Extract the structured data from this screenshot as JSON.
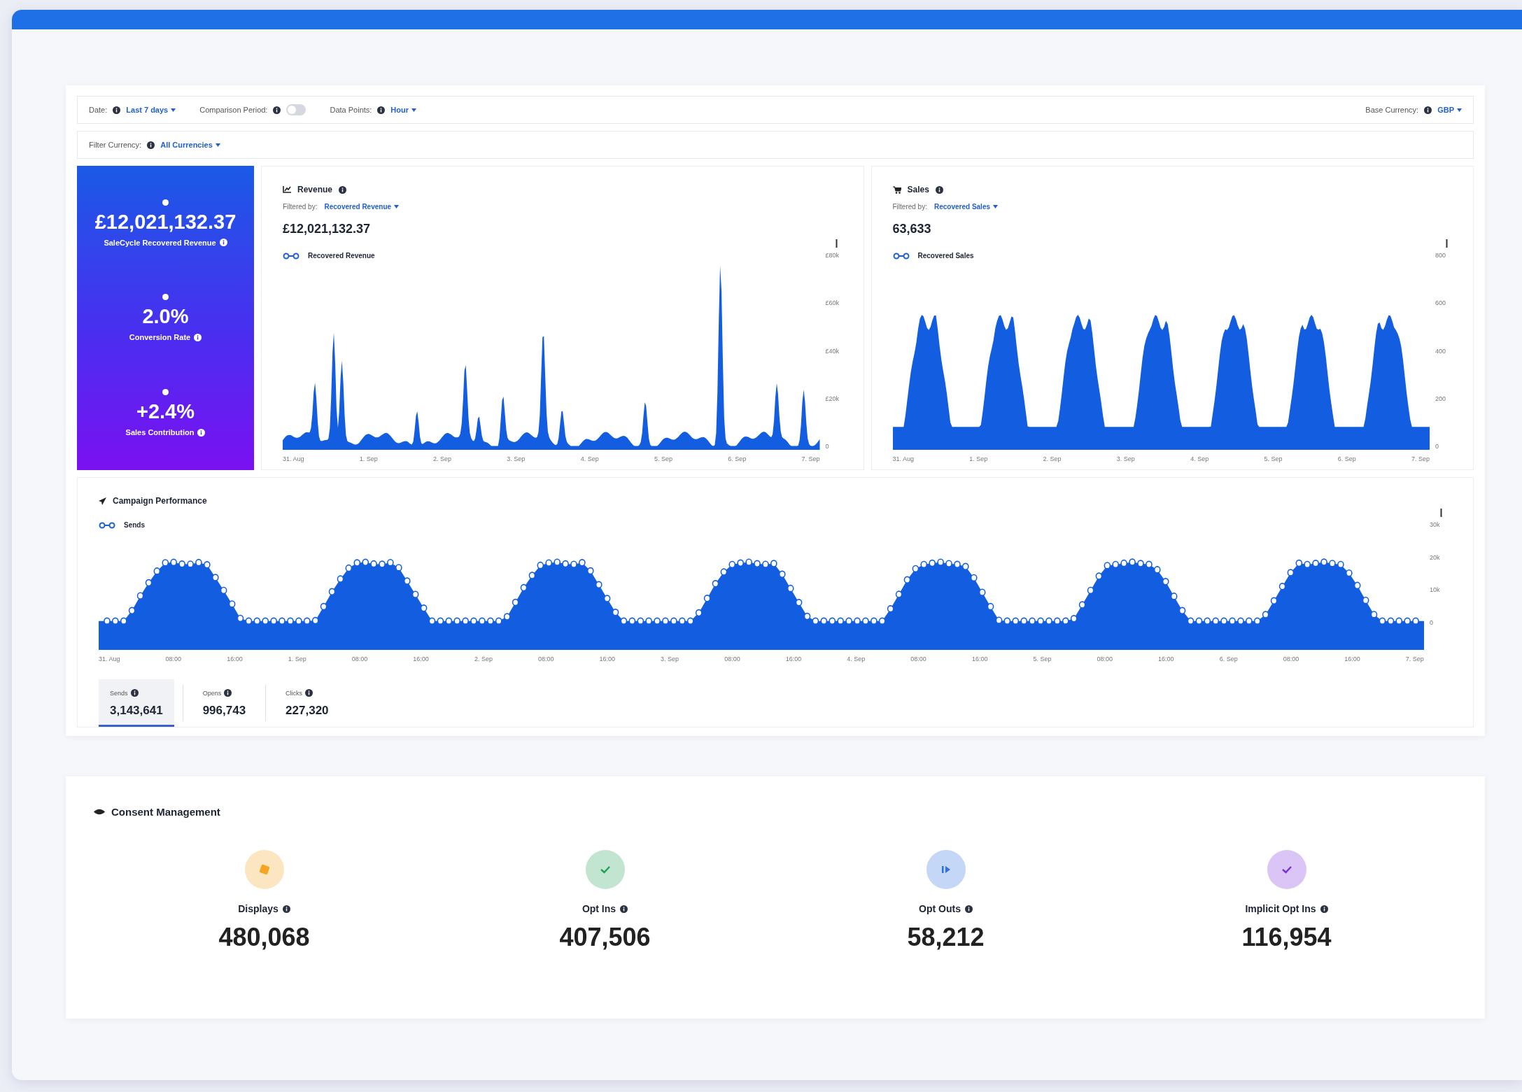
{
  "filters": {
    "items": [
      {
        "kind": "dropdown",
        "label": "Date:",
        "value": "Last 7 days"
      },
      {
        "kind": "toggle",
        "label": "Comparison Period:",
        "on": false
      },
      {
        "kind": "dropdown",
        "label": "Data Points:",
        "value": "Hour"
      }
    ],
    "base_currency": {
      "label": "Base Currency:",
      "value": "GBP"
    },
    "filter_currency": {
      "label": "Filter Currency:",
      "value": "All Currencies"
    }
  },
  "kpis": [
    {
      "value": "£12,021,132.37",
      "label": "SaleCycle Recovered Revenue"
    },
    {
      "value": "2.0%",
      "label": "Conversion Rate"
    },
    {
      "value": "+2.4%",
      "label": "Sales Contribution"
    }
  ],
  "revenue": {
    "title": "Revenue",
    "filter_label": "Filtered by:",
    "filter_value": "Recovered Revenue",
    "total": "£12,021,132.37",
    "legend": "Recovered Revenue",
    "y_labels": [
      "£80k",
      "£60k",
      "£40k",
      "£20k",
      "0"
    ],
    "x_labels": [
      "31. Aug",
      "1. Sep",
      "2. Sep",
      "3. Sep",
      "4. Sep",
      "5. Sep",
      "6. Sep",
      "7. Sep"
    ]
  },
  "sales": {
    "title": "Sales",
    "filter_label": "Filtered by:",
    "filter_value": "Recovered Sales",
    "total": "63,633",
    "legend": "Recovered Sales",
    "y_labels": [
      "800",
      "600",
      "400",
      "200",
      "0"
    ],
    "x_labels": [
      "31. Aug",
      "1. Sep",
      "2. Sep",
      "3. Sep",
      "4. Sep",
      "5. Sep",
      "6. Sep",
      "7. Sep"
    ]
  },
  "campaign": {
    "title": "Campaign Performance",
    "legend": "Sends",
    "y_labels": [
      "30k",
      "20k",
      "10k",
      "0"
    ],
    "x_labels": [
      "31. Aug",
      "08:00",
      "16:00",
      "1. Sep",
      "08:00",
      "16:00",
      "2. Sep",
      "08:00",
      "16:00",
      "3. Sep",
      "08:00",
      "16:00",
      "4. Sep",
      "08:00",
      "16:00",
      "5. Sep",
      "08:00",
      "16:00",
      "6. Sep",
      "08:00",
      "16:00",
      "7. Sep"
    ],
    "tabs": [
      {
        "label": "Sends",
        "value": "3,143,641",
        "selected": true
      },
      {
        "label": "Opens",
        "value": "996,743",
        "selected": false
      },
      {
        "label": "Clicks",
        "value": "227,320",
        "selected": false
      }
    ]
  },
  "consent": {
    "title": "Consent Management",
    "stats": [
      {
        "kind": "displays",
        "label": "Displays",
        "value": "480,068",
        "color": "#f5a524"
      },
      {
        "kind": "opt-in",
        "label": "Opt Ins",
        "value": "407,506",
        "color": "#22a05a"
      },
      {
        "kind": "opt-out",
        "label": "Opt Outs",
        "value": "58,212",
        "color": "#2f6fe0"
      },
      {
        "kind": "implicit",
        "label": "Implicit Opt Ins",
        "value": "116,954",
        "color": "#7a2fe0"
      }
    ]
  }
}
